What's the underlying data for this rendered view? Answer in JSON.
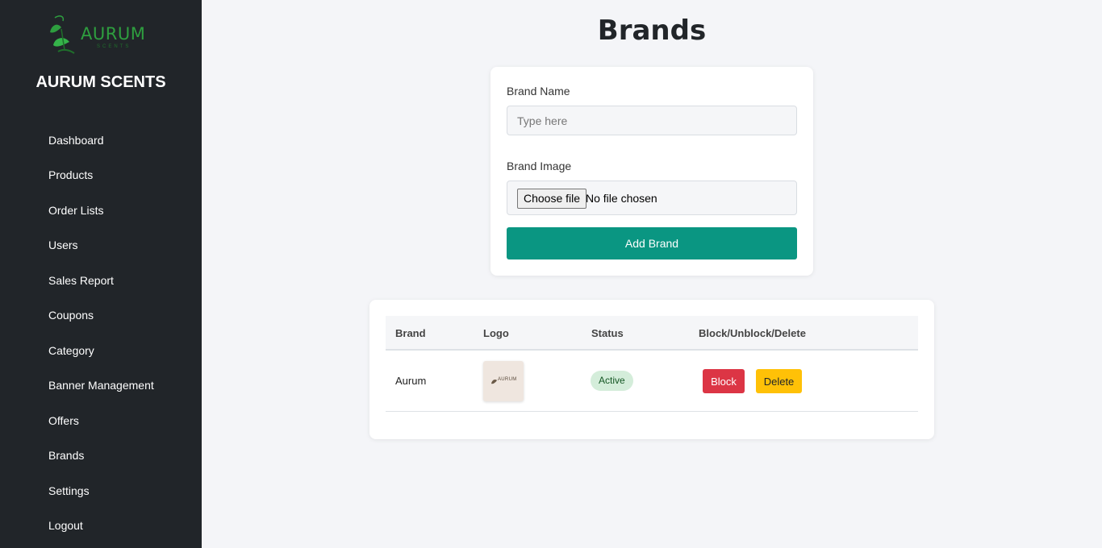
{
  "sidebar": {
    "logo_text": "AURUM",
    "logo_subtext": "SCENTS",
    "brand_name": "AURUM SCENTS",
    "nav_items": [
      {
        "label": "Dashboard"
      },
      {
        "label": "Products"
      },
      {
        "label": "Order Lists"
      },
      {
        "label": "Users"
      },
      {
        "label": "Sales Report"
      },
      {
        "label": "Coupons"
      },
      {
        "label": "Category"
      },
      {
        "label": "Banner Management"
      },
      {
        "label": "Offers"
      },
      {
        "label": "Brands"
      },
      {
        "label": "Settings"
      },
      {
        "label": "Logout"
      }
    ]
  },
  "page": {
    "title": "Brands"
  },
  "form": {
    "brand_name_label": "Brand Name",
    "brand_name_placeholder": "Type here",
    "brand_name_value": "",
    "brand_image_label": "Brand Image",
    "choose_file_label": "Choose file",
    "file_status": "No file chosen",
    "submit_label": "Add Brand"
  },
  "table": {
    "columns": [
      "Brand",
      "Logo",
      "Status",
      "Block/Unblock/Delete"
    ],
    "rows": [
      {
        "brand": "Aurum",
        "logo_text": "AURUM",
        "status": "Active",
        "block_label": "Block",
        "delete_label": "Delete"
      }
    ]
  },
  "colors": {
    "sidebar_bg": "#212529",
    "accent_green": "#0a9682",
    "logo_green": "#2e9e3f",
    "danger": "#dc3545",
    "warning": "#ffc107",
    "status_active_bg": "#d4edda"
  },
  "icons": {
    "logo": "leaf-monogram-icon",
    "logo_thumb": "brand-logo-image"
  }
}
